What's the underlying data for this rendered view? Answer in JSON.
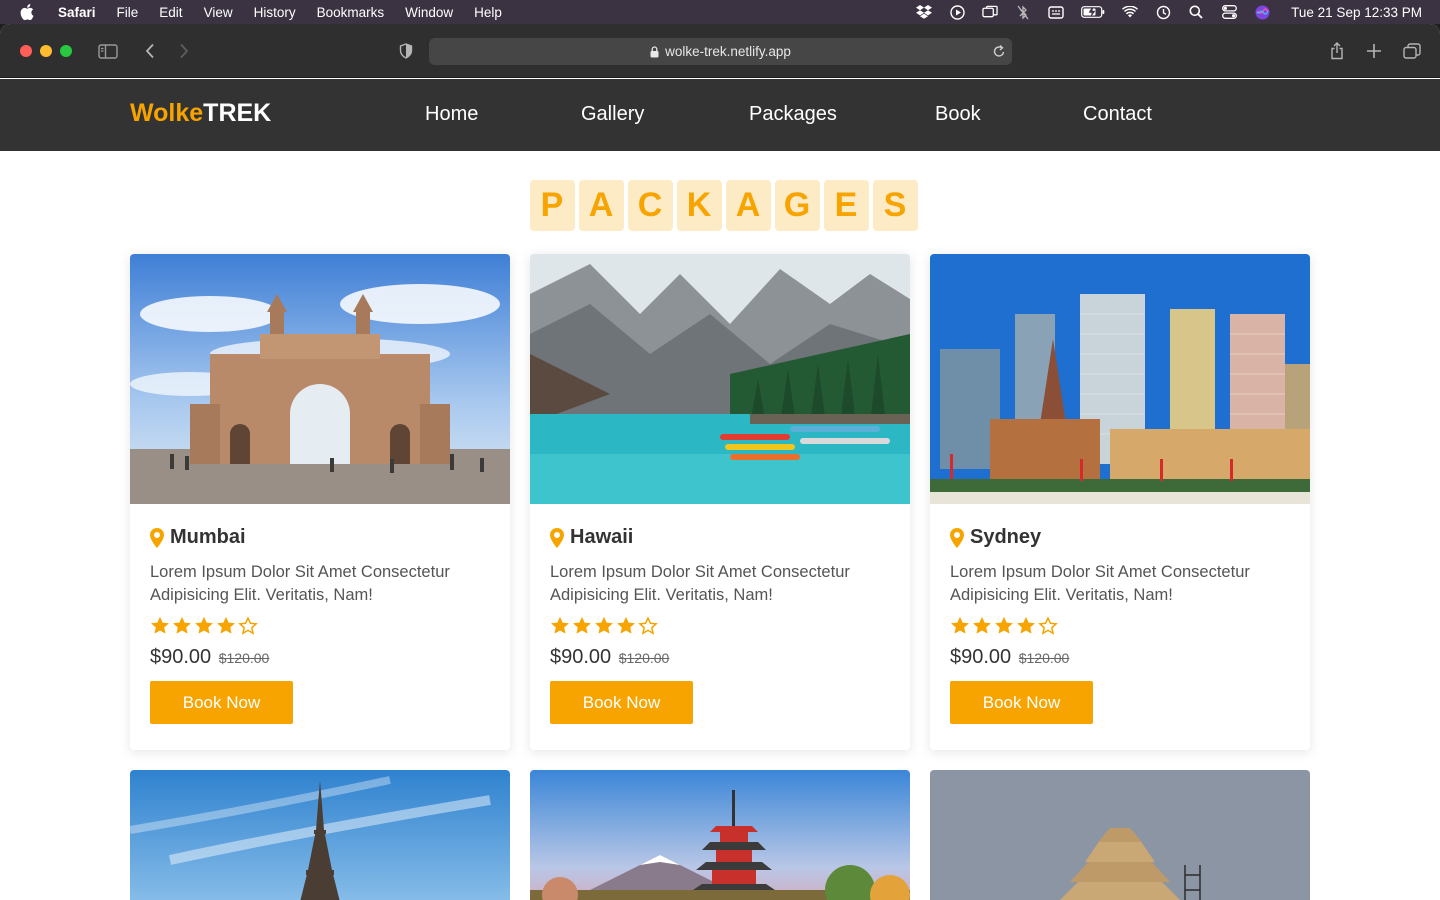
{
  "menubar": {
    "app": "Safari",
    "items": [
      "File",
      "Edit",
      "View",
      "History",
      "Bookmarks",
      "Window",
      "Help"
    ],
    "clock": "Tue 21 Sep  12:33 PM"
  },
  "browser": {
    "url": "wolke-trek.netlify.app"
  },
  "site": {
    "logo_a": "Wolke",
    "logo_b": "TREK",
    "nav": [
      "Home",
      "Gallery",
      "Packages",
      "Book",
      "Contact"
    ],
    "heading_letters": [
      "P",
      "A",
      "C",
      "K",
      "A",
      "G",
      "E",
      "S"
    ],
    "packages": [
      {
        "city": "Mumbai",
        "description": "Lorem Ipsum Dolor Sit Amet Consectetur Adipisicing Elit. Veritatis, Nam!",
        "rating": 4,
        "rating_max": 5,
        "price": "$90.00",
        "old_price": "$120.00",
        "button": "Book Now",
        "image": "gateway-of-india-photo"
      },
      {
        "city": "Hawaii",
        "description": "Lorem Ipsum Dolor Sit Amet Consectetur Adipisicing Elit. Veritatis, Nam!",
        "rating": 4,
        "rating_max": 5,
        "price": "$90.00",
        "old_price": "$120.00",
        "button": "Book Now",
        "image": "mountain-lake-canoes-photo"
      },
      {
        "city": "Sydney",
        "description": "Lorem Ipsum Dolor Sit Amet Consectetur Adipisicing Elit. Veritatis, Nam!",
        "rating": 4,
        "rating_max": 5,
        "price": "$90.00",
        "old_price": "$120.00",
        "button": "Book Now",
        "image": "sydney-skyline-photo"
      }
    ],
    "more_images": [
      "eiffel-tower-photo",
      "pagoda-mount-fuji-photo",
      "step-pyramid-photo"
    ]
  },
  "colors": {
    "accent": "#f7a400",
    "nav_bg": "#333333",
    "heading_tile": "#fdebc6"
  }
}
